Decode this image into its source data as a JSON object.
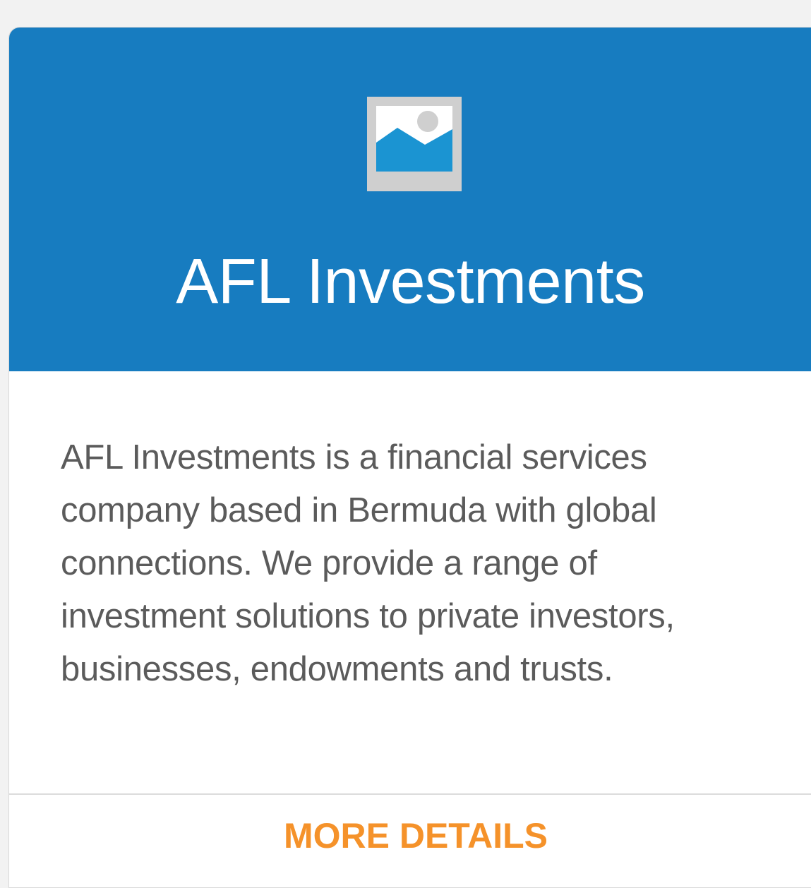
{
  "card": {
    "title": "AFL Investments",
    "image_icon": "image-placeholder-icon",
    "description": "AFL Investments is a financial services company based in Bermuda with global connections. We provide a range of investment solutions to private investors, businesses, endowments and trusts.",
    "action_label": "MORE DETAILS"
  },
  "colors": {
    "header_background": "#177cc0",
    "action_text": "#f5922a",
    "body_text": "#5b5b5b",
    "page_background": "#f2f2f2"
  }
}
